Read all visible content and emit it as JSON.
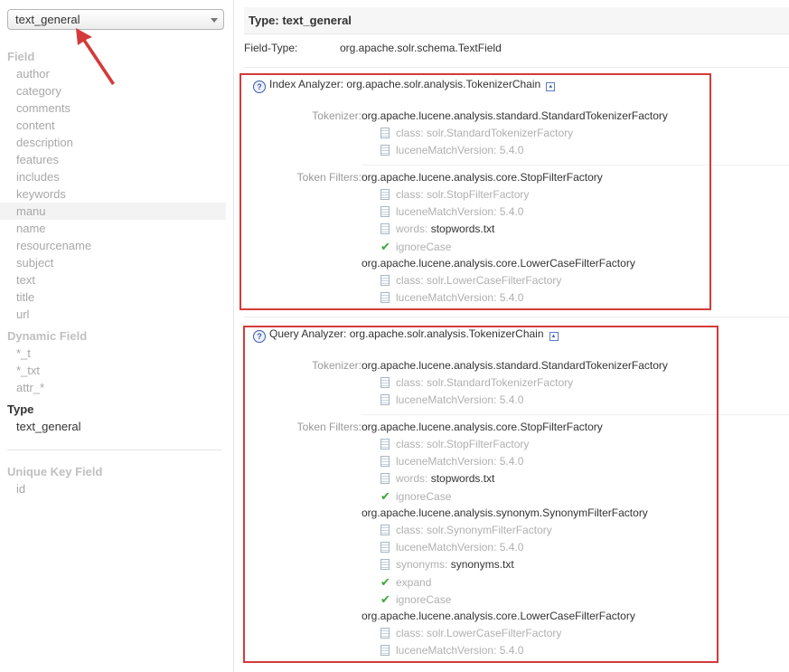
{
  "sidebar": {
    "type_select": {
      "value": "text_general"
    },
    "field_heading": "Field",
    "fields": [
      "author",
      "category",
      "comments",
      "content",
      "description",
      "features",
      "includes",
      "keywords",
      "manu",
      "name",
      "resourcename",
      "subject",
      "text",
      "title",
      "url"
    ],
    "dynamic_heading": "Dynamic Field",
    "dynamic_fields": [
      "*_t",
      "*_txt",
      "attr_*"
    ],
    "type_heading": "Type",
    "types": [
      "text_general"
    ],
    "unique_heading": "Unique Key Field",
    "unique_fields": [
      "id"
    ]
  },
  "main": {
    "title": "Type: text_general",
    "field_type_label": "Field-Type:",
    "field_type_value": "org.apache.solr.schema.TextField",
    "index": {
      "help": "?",
      "label": "Index Analyzer:",
      "class": "org.apache.solr.analysis.TokenizerChain",
      "collapse": "▴",
      "tokenizer_label": "Tokenizer:",
      "tokenizer_class": "org.apache.lucene.analysis.standard.StandardTokenizerFactory",
      "tokenizer_props": [
        {
          "key": "class:",
          "val": "solr.StandardTokenizerFactory"
        },
        {
          "key": "luceneMatchVersion:",
          "val": "5.4.0"
        }
      ],
      "filters_label": "Token Filters:",
      "stop_class": "org.apache.lucene.analysis.core.StopFilterFactory",
      "stop_props": [
        {
          "key": "class:",
          "val": "solr.StopFilterFactory"
        },
        {
          "key": "luceneMatchVersion:",
          "val": "5.4.0"
        },
        {
          "key": "words:",
          "val": "stopwords.txt"
        }
      ],
      "stop_flag": "ignoreCase",
      "lower_class": "org.apache.lucene.analysis.core.LowerCaseFilterFactory",
      "lower_props": [
        {
          "key": "class:",
          "val": "solr.LowerCaseFilterFactory"
        },
        {
          "key": "luceneMatchVersion:",
          "val": "5.4.0"
        }
      ]
    },
    "query": {
      "help": "?",
      "label": "Query Analyzer:",
      "class": "org.apache.solr.analysis.TokenizerChain",
      "collapse": "▴",
      "tokenizer_label": "Tokenizer:",
      "tokenizer_class": "org.apache.lucene.analysis.standard.StandardTokenizerFactory",
      "tokenizer_props": [
        {
          "key": "class:",
          "val": "solr.StandardTokenizerFactory"
        },
        {
          "key": "luceneMatchVersion:",
          "val": "5.4.0"
        }
      ],
      "filters_label": "Token Filters:",
      "stop_class": "org.apache.lucene.analysis.core.StopFilterFactory",
      "stop_props": [
        {
          "key": "class:",
          "val": "solr.StopFilterFactory"
        },
        {
          "key": "luceneMatchVersion:",
          "val": "5.4.0"
        },
        {
          "key": "words:",
          "val": "stopwords.txt"
        }
      ],
      "stop_flag": "ignoreCase",
      "syn_class": "org.apache.lucene.analysis.synonym.SynonymFilterFactory",
      "syn_props": [
        {
          "key": "class:",
          "val": "solr.SynonymFilterFactory"
        },
        {
          "key": "luceneMatchVersion:",
          "val": "5.4.0"
        },
        {
          "key": "synonyms:",
          "val": "synonyms.txt"
        }
      ],
      "syn_flags": [
        "expand",
        "ignoreCase"
      ],
      "lower_class": "org.apache.lucene.analysis.core.LowerCaseFilterFactory",
      "lower_props": [
        {
          "key": "class:",
          "val": "solr.LowerCaseFilterFactory"
        },
        {
          "key": "luceneMatchVersion:",
          "val": "5.4.0"
        }
      ]
    }
  },
  "colors": {
    "annotation": "#d43a3a",
    "check": "#3aa83a",
    "help": "#3a5aa8"
  },
  "icons": {
    "prop": "document-icon",
    "flag": "checkmark-icon",
    "help": "help-icon",
    "collapse": "collapse-icon",
    "select": "chevron-down-icon"
  }
}
